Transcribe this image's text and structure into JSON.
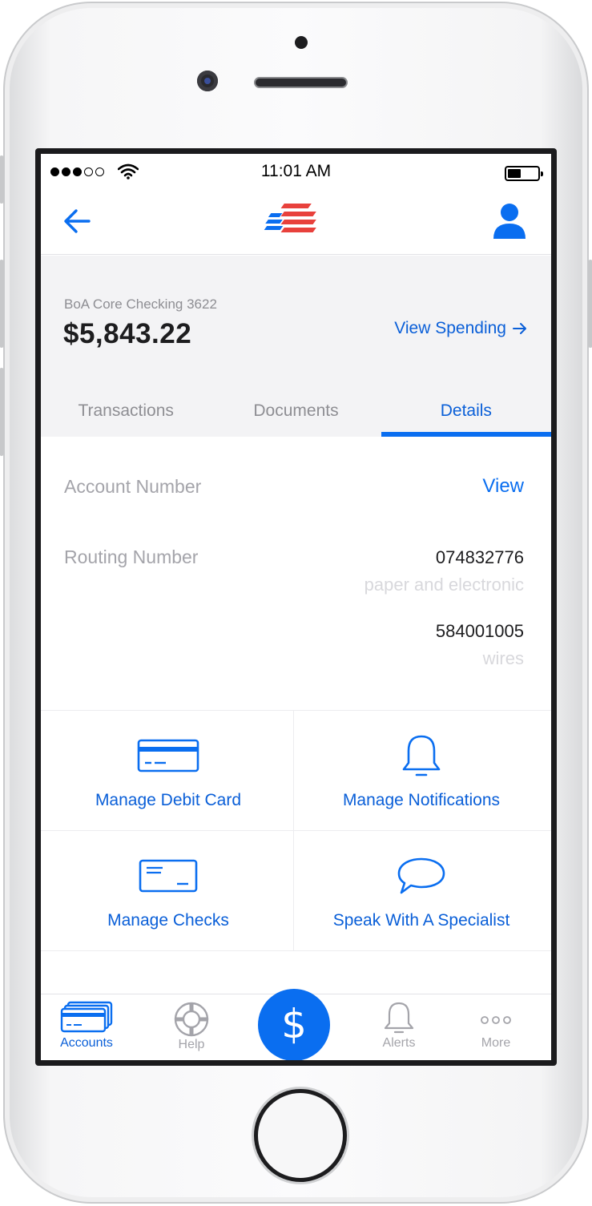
{
  "status_bar": {
    "time": "11:01 AM"
  },
  "account": {
    "name": "BoA Core Checking 3622",
    "balance": "$5,843.22",
    "view_spending_label": "View Spending"
  },
  "tabs": [
    {
      "label": "Transactions",
      "active": false
    },
    {
      "label": "Documents",
      "active": false
    },
    {
      "label": "Details",
      "active": true
    }
  ],
  "details": {
    "account_number_label": "Account Number",
    "account_number_action": "View",
    "routing_number_label": "Routing Number",
    "routing": [
      {
        "number": "074832776",
        "type": "paper and electronic"
      },
      {
        "number": "584001005",
        "type": "wires"
      }
    ]
  },
  "actions": [
    {
      "label": "Manage Debit Card",
      "icon": "debit-card-icon"
    },
    {
      "label": "Manage Notifications",
      "icon": "bell-icon"
    },
    {
      "label": "Manage Checks",
      "icon": "check-icon"
    },
    {
      "label": "Speak With A Specialist",
      "icon": "chat-bubble-icon"
    }
  ],
  "tab_bar": {
    "items": [
      {
        "label": "Accounts",
        "icon": "cards-icon",
        "active": true
      },
      {
        "label": "Help",
        "icon": "lifebuoy-icon",
        "active": false
      },
      {
        "label": "$",
        "icon": "dollar-icon",
        "active": false
      },
      {
        "label": "Alerts",
        "icon": "bell-icon",
        "active": false
      },
      {
        "label": "More",
        "icon": "more-dots-icon",
        "active": false
      }
    ]
  },
  "colors": {
    "accent": "#0a6ef0",
    "link": "#0a5fd8",
    "header_bg": "#f3f3f5",
    "logo_red": "#e8413c",
    "logo_blue": "#0a6ef0"
  }
}
